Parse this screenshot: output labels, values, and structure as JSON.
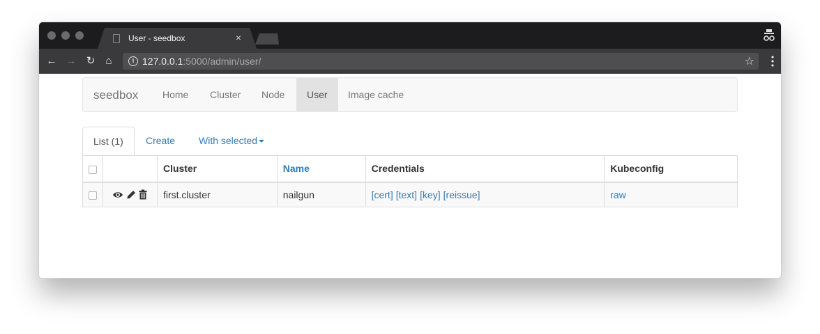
{
  "browser": {
    "tab_title": "User - seedbox",
    "tab_close": "×",
    "url_host": "127.0.0.1",
    "url_rest": ":5000/admin/user/"
  },
  "icons": {
    "back": "back-arrow-icon",
    "forward": "forward-arrow-icon",
    "reload": "reload-icon",
    "home": "home-icon",
    "info": "info-icon",
    "star": "star-icon",
    "menu": "kebab-menu-icon",
    "incognito": "incognito-icon",
    "view": "eye-icon",
    "edit": "pencil-icon",
    "delete": "trash-icon"
  },
  "navbar": {
    "brand": "seedbox",
    "items": [
      {
        "label": "Home"
      },
      {
        "label": "Cluster"
      },
      {
        "label": "Node"
      },
      {
        "label": "User",
        "active": true
      },
      {
        "label": "Image cache"
      }
    ]
  },
  "tabs": {
    "list": "List (1)",
    "create": "Create",
    "with_selected": "With selected"
  },
  "table": {
    "columns": [
      "Cluster",
      "Name",
      "Credentials",
      "Kubeconfig"
    ],
    "rows": [
      {
        "cluster": "first.cluster",
        "name": "nailgun",
        "credentials": [
          "[cert]",
          "[text]",
          "[key]",
          "[reissue]"
        ],
        "kubeconfig": "raw"
      }
    ]
  },
  "colors": {
    "link": "#337ab7",
    "navbar_bg": "#f8f8f8",
    "nav_active_bg": "#e2e2e2",
    "chrome_dark": "#1c1c1e",
    "chrome_toolbar": "#3a3a3c"
  }
}
